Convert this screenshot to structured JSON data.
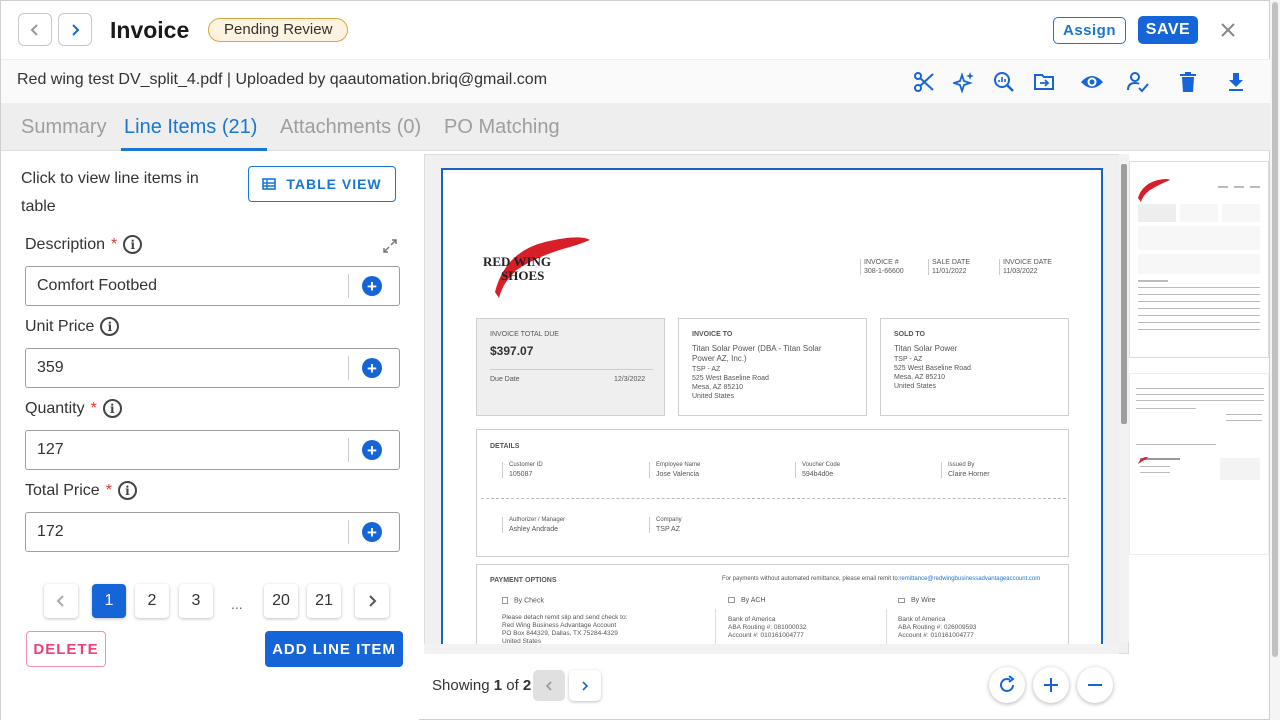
{
  "header": {
    "title": "Invoice",
    "status": "Pending Review",
    "assign_label": "Assign",
    "save_label": "SAVE"
  },
  "subheader": {
    "filename": "Red wing test DV_split_4.pdf | Uploaded by qaautomation.briq@gmail.com",
    "tools": [
      "scissors-icon",
      "sparkle-icon",
      "analytics-search-icon",
      "move-folder-icon",
      "eye-icon",
      "user-check-icon",
      "trash-icon",
      "download-icon"
    ]
  },
  "tabs": [
    {
      "label": "Summary"
    },
    {
      "label": "Line Items (21)"
    },
    {
      "label": "Attachments (0)"
    },
    {
      "label": "PO Matching"
    }
  ],
  "left": {
    "hint": "Click to view line items in table",
    "table_view_label": "TABLE VIEW",
    "fields": [
      {
        "label": "Description",
        "required": true,
        "value": "Comfort Footbed"
      },
      {
        "label": "Unit Price",
        "required": false,
        "value": "359"
      },
      {
        "label": "Quantity",
        "required": true,
        "value": "127"
      },
      {
        "label": "Total Price",
        "required": true,
        "value": "172"
      }
    ],
    "pagination": [
      "1",
      "2",
      "3",
      "...",
      "20",
      "21"
    ],
    "current_page": "1",
    "delete_label": "DELETE",
    "add_label": "ADD LINE ITEM"
  },
  "viewer": {
    "showing_prefix": "Showing",
    "current": "1",
    "of": "of",
    "total": "2"
  },
  "doc": {
    "logo_line1": "RED WING",
    "logo_line2": "SHOES",
    "invoice_no_label": "INVOICE #",
    "invoice_no": "308-1-66600",
    "sale_date_label": "SALE DATE",
    "sale_date": "11/01/2022",
    "invoice_date_label": "INVOICE DATE",
    "invoice_date": "11/03/2022",
    "total_due_label": "INVOICE TOTAL DUE",
    "total_due": "$397.07",
    "due_date_label": "Due Date",
    "due_date": "12/3/2022",
    "invoice_to_label": "INVOICE TO",
    "invoice_to_name": "Titan Solar Power (DBA - Titan Solar Power AZ, Inc.)",
    "invoice_to_l1": "TSP - AZ",
    "invoice_to_l2": "525 West Baseline Road",
    "invoice_to_l3": "Mesa, AZ 85210",
    "invoice_to_l4": "United States",
    "sold_to_label": "SOLD TO",
    "sold_to_name": "Titan Solar Power",
    "sold_to_l1": "TSP - AZ",
    "sold_to_l2": "525 West Baseline Road",
    "sold_to_l3": "Mesa, AZ 85210",
    "sold_to_l4": "United States",
    "details_label": "DETAILS",
    "customer_id_label": "Customer ID",
    "customer_id": "105087",
    "employee_label": "Employee Name",
    "employee": "Jose Valencia",
    "voucher_label": "Voucher Code",
    "voucher": "594b4d0e",
    "issued_label": "Issued By",
    "issued": "Claire Horner",
    "authorizer_label": "Authorizer / Manager",
    "authorizer": "Ashley Andrade",
    "company_label": "Company",
    "company": "TSP AZ",
    "payment_label": "PAYMENT OPTIONS",
    "payment_note": "For payments without automated remittance, please email remit to:",
    "payment_email": "remittance@redwingbusinessadvantageaccount.com",
    "check_label": "By Check",
    "check_l1": "Please detach remit slip and send check to:",
    "check_l2": "Red Wing Business Advantage Account",
    "check_l3": "PO Box 844329, Dallas, TX 75284-4329",
    "check_l4": "United States",
    "ach_label": "By ACH",
    "ach_l1": "Bank of America",
    "ach_l2": "ABA Routing #: 081000032",
    "ach_l3": "Account #: 010161004777",
    "wire_label": "By Wire",
    "wire_l1": "Bank of America",
    "wire_l2": "ABA Routing #: 026009593",
    "wire_l3": "Account #: 010161004777"
  },
  "colors": {
    "primary": "#1565d8",
    "badge_border": "#d8a640",
    "delete": "#ec407a"
  }
}
